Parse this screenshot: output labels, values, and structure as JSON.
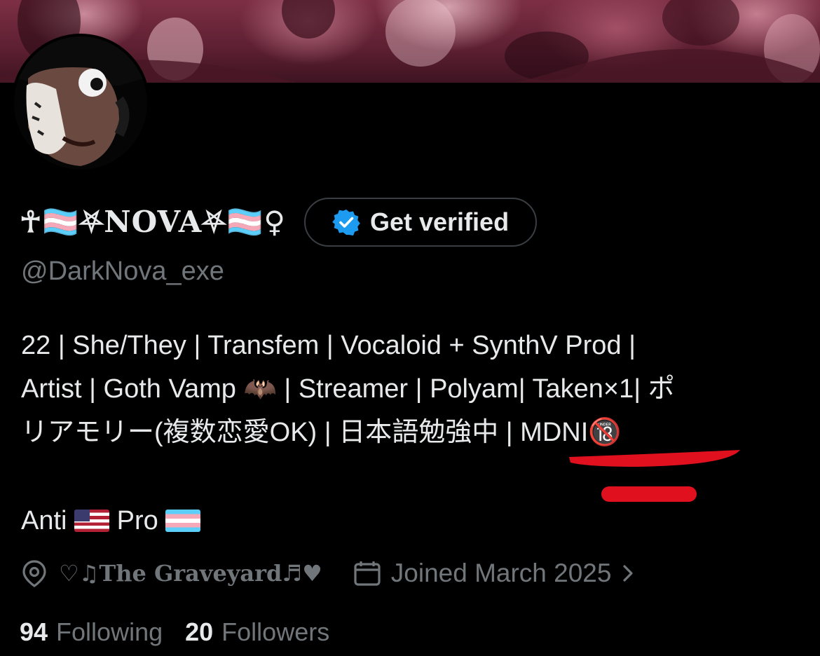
{
  "profile": {
    "display_name": "☥🏳️‍⚧️⛧NOVA⛧🏳️‍⚧️♀",
    "display_name_text": "NOVA",
    "handle": "@DarkNova_exe",
    "verify_button_label": "Get verified",
    "bio": {
      "line1": "22 | She/They | Transfem | Vocaloid + SynthV Prod |",
      "line2_a": "Artist | Goth Vamp ",
      "line2_bat": "🦇",
      "line2_b": " | Streamer | Polyam| Taken×1| ポ",
      "line3": "リアモリー(複数恋愛OK) | 日本語勉強中 | MDNI",
      "line3_badge": "🔞",
      "line4_anti": "Anti ",
      "line4_pro": " Pro "
    },
    "location": "♡♫The Graveyard♬♥",
    "joined": "Joined March 2025",
    "following_count": "94",
    "following_label": "Following",
    "followers_count": "20",
    "followers_label": "Followers"
  },
  "icons": {
    "verified": "verified-badge-icon",
    "location": "location-pin-icon",
    "calendar": "calendar-icon",
    "chevron": "chevron-right-icon"
  },
  "colors": {
    "background": "#000000",
    "text_primary": "#e7e9ea",
    "text_secondary": "#71767b",
    "verified_blue": "#1d9bf0",
    "annotation_red": "#e0101e"
  }
}
